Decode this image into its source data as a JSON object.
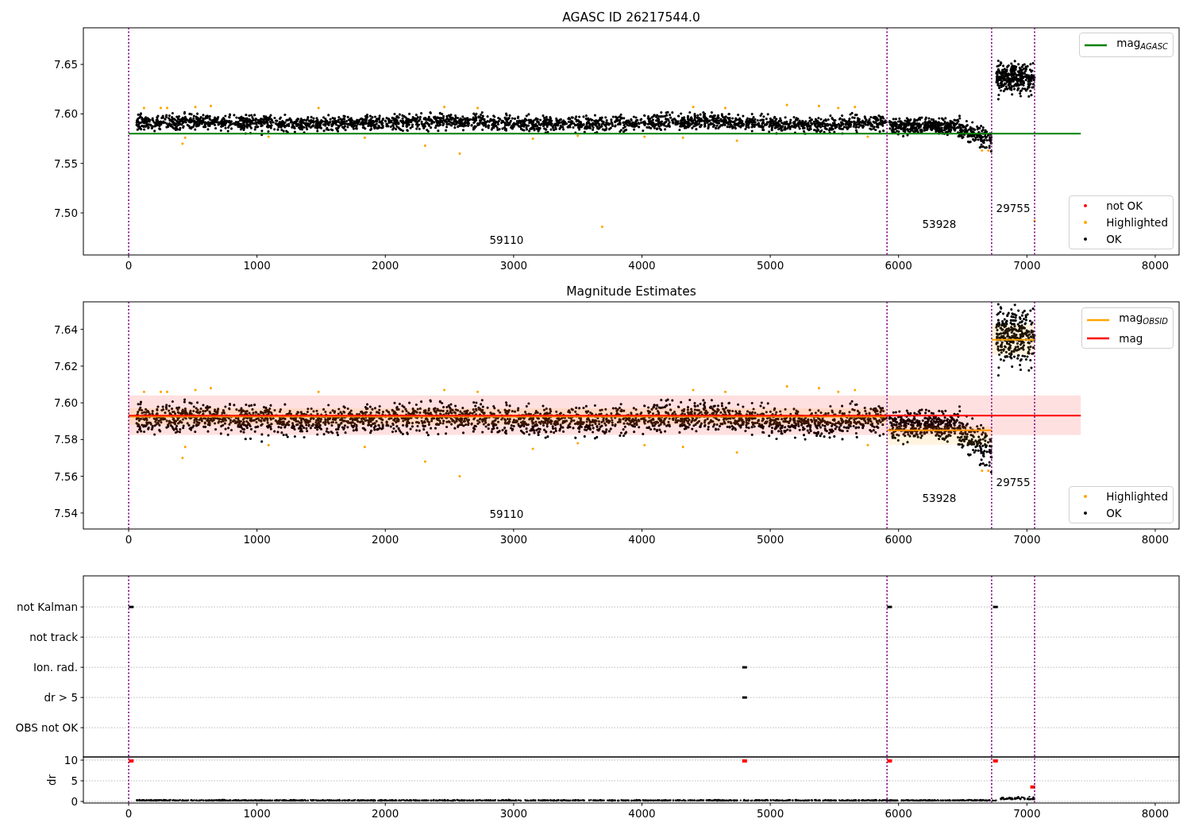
{
  "figure": {
    "panels": [
      {
        "kind": "magnitude",
        "title": "AGASC ID 26217544.0",
        "chart_data": {
          "type": "line",
          "xlim": [
            -353,
            8186
          ],
          "ylim": [
            7.4575,
            7.687
          ],
          "xticks": [
            0,
            1000,
            2000,
            3000,
            4000,
            5000,
            6000,
            7000,
            8000
          ],
          "yticks": [
            {
              "value": 7.5,
              "label": "7.50"
            },
            {
              "value": 7.55,
              "label": "7.55"
            },
            {
              "value": 7.6,
              "label": "7.60"
            },
            {
              "value": 7.65,
              "label": "7.65"
            }
          ],
          "x": [
            0,
            7420
          ],
          "series": [
            {
              "name": "mag$_{AGASC}$",
              "color": "#008000",
              "values": [
                7.58,
                7.58
              ]
            }
          ]
        },
        "annotations": [
          "59110",
          "53928",
          "29755"
        ],
        "legends": [
          {
            "kind": "series"
          },
          {
            "kind": "markers",
            "items": [
              {
                "label": "not OK",
                "color": "#ff0000"
              },
              {
                "label": "Highlighted",
                "color": "#ffa500"
              },
              {
                "label": "OK",
                "color": "#000000"
              }
            ]
          }
        ]
      },
      {
        "kind": "estimates",
        "title": "Magnitude Estimates",
        "chart_data": {
          "type": "line",
          "xlim": [
            -353,
            8186
          ],
          "ylim": [
            7.5313,
            7.655
          ],
          "xticks": [
            0,
            1000,
            2000,
            3000,
            4000,
            5000,
            6000,
            7000,
            8000
          ],
          "yticks": [
            {
              "value": 7.54,
              "label": "7.54"
            },
            {
              "value": 7.56,
              "label": "7.56"
            },
            {
              "value": 7.58,
              "label": "7.58"
            },
            {
              "value": 7.6,
              "label": "7.60"
            },
            {
              "value": 7.62,
              "label": "7.62"
            },
            {
              "value": 7.64,
              "label": "7.64"
            }
          ],
          "x": [
            0,
            5910,
            5910,
            5910,
            6725,
            6725,
            6725,
            7060,
            7420
          ],
          "series": [
            {
              "name": "mag$_{OBSID}$",
              "color": "#ffa500",
              "values": [
                7.5925,
                7.5925,
                null,
                7.585,
                7.585,
                null,
                7.6344,
                7.6344,
                null
              ]
            },
            {
              "name": "mag",
              "color": "#ff0000",
              "values": [
                7.593,
                7.593,
                7.593,
                7.593,
                7.593,
                7.593,
                7.593,
                7.593,
                7.593
              ]
            }
          ]
        },
        "annotations": [
          "59110",
          "53928",
          "29755"
        ],
        "legends": [
          {
            "kind": "series"
          },
          {
            "kind": "markers",
            "items": [
              {
                "label": "Highlighted",
                "color": "#ffa500"
              },
              {
                "label": "OK",
                "color": "#000000"
              }
            ]
          }
        ]
      },
      {
        "kind": "flags",
        "flags_chart": {
          "labels": [
            "not Kalman",
            "not track",
            "Ion. rad.",
            "dr > 5",
            "OBS not OK"
          ]
        },
        "dr_chart": {
          "chart_data": {
            "type": "scatter",
            "ylabel": "dr",
            "xlim": [
              -353,
              8186
            ],
            "ylim": [
              -0.38,
              10.77
            ],
            "xticks": [
              0,
              1000,
              2000,
              3000,
              4000,
              5000,
              6000,
              7000,
              8000
            ],
            "yticks": [
              {
                "value": 0,
                "label": "0"
              },
              {
                "value": 5,
                "label": "5"
              },
              {
                "value": 10,
                "label": "10"
              }
            ],
            "x": [
              20,
              5930,
              6755,
              4800,
              7045
            ],
            "series": [
              {
                "color": "#ff0000",
                "values": [
                  9.8,
                  9.8,
                  9.8,
                  9.8,
                  3.5
                ]
              }
            ]
          }
        }
      }
    ]
  }
}
